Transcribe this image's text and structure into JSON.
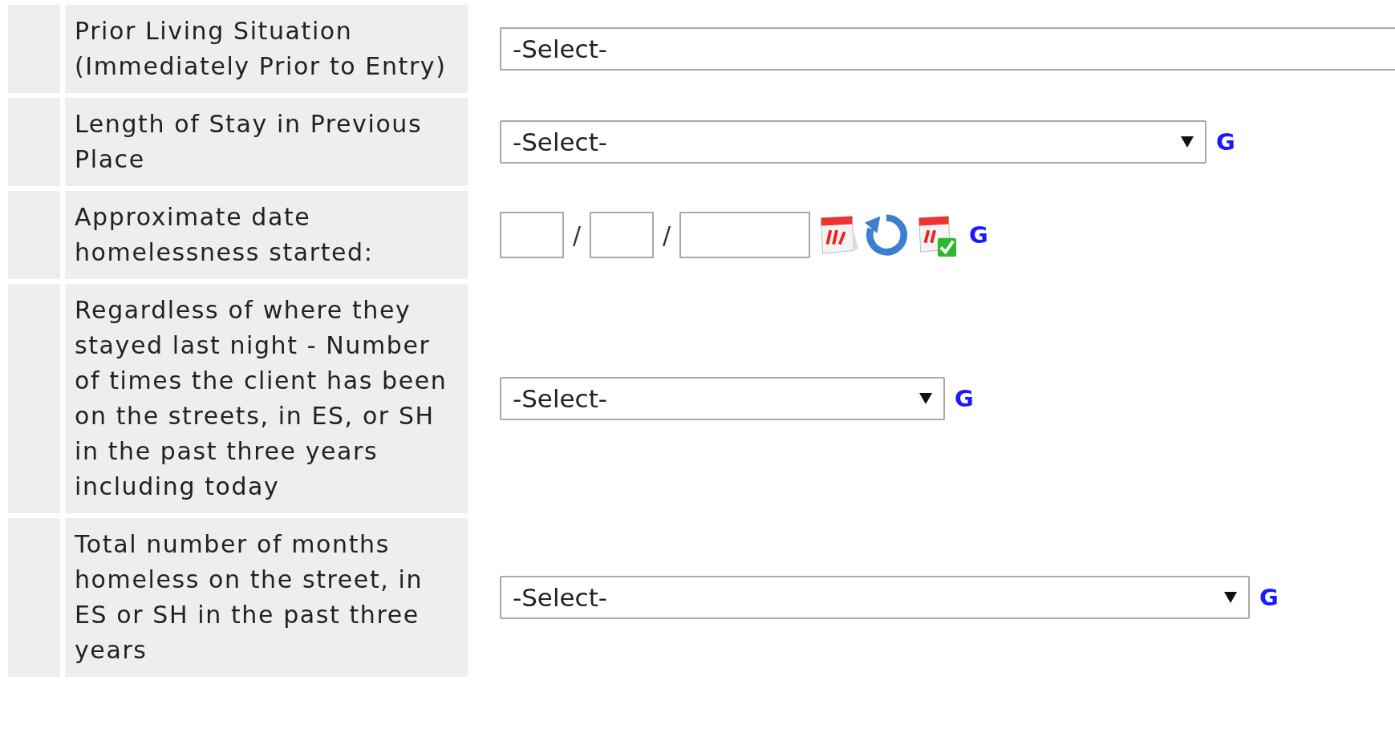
{
  "rows": [
    {
      "label": "Prior Living Situation (Immediately Prior to Entry)",
      "kind": "select",
      "value": "-Select-"
    },
    {
      "label": "Length of Stay in Previous Place",
      "kind": "select",
      "value": "-Select-",
      "link": "G"
    },
    {
      "label": "Approximate date homelessness started:",
      "kind": "date",
      "separators": [
        "/",
        "/"
      ],
      "link": "G"
    },
    {
      "label": "Regardless of where they stayed last night - Number of times the client has been on the streets, in ES, or SH in the past three years including today",
      "kind": "select",
      "value": "-Select-",
      "link": "G"
    },
    {
      "label": "Total number of months homeless on the street, in ES or SH in the past three years",
      "kind": "select",
      "value": "-Select-",
      "link": "G"
    }
  ]
}
